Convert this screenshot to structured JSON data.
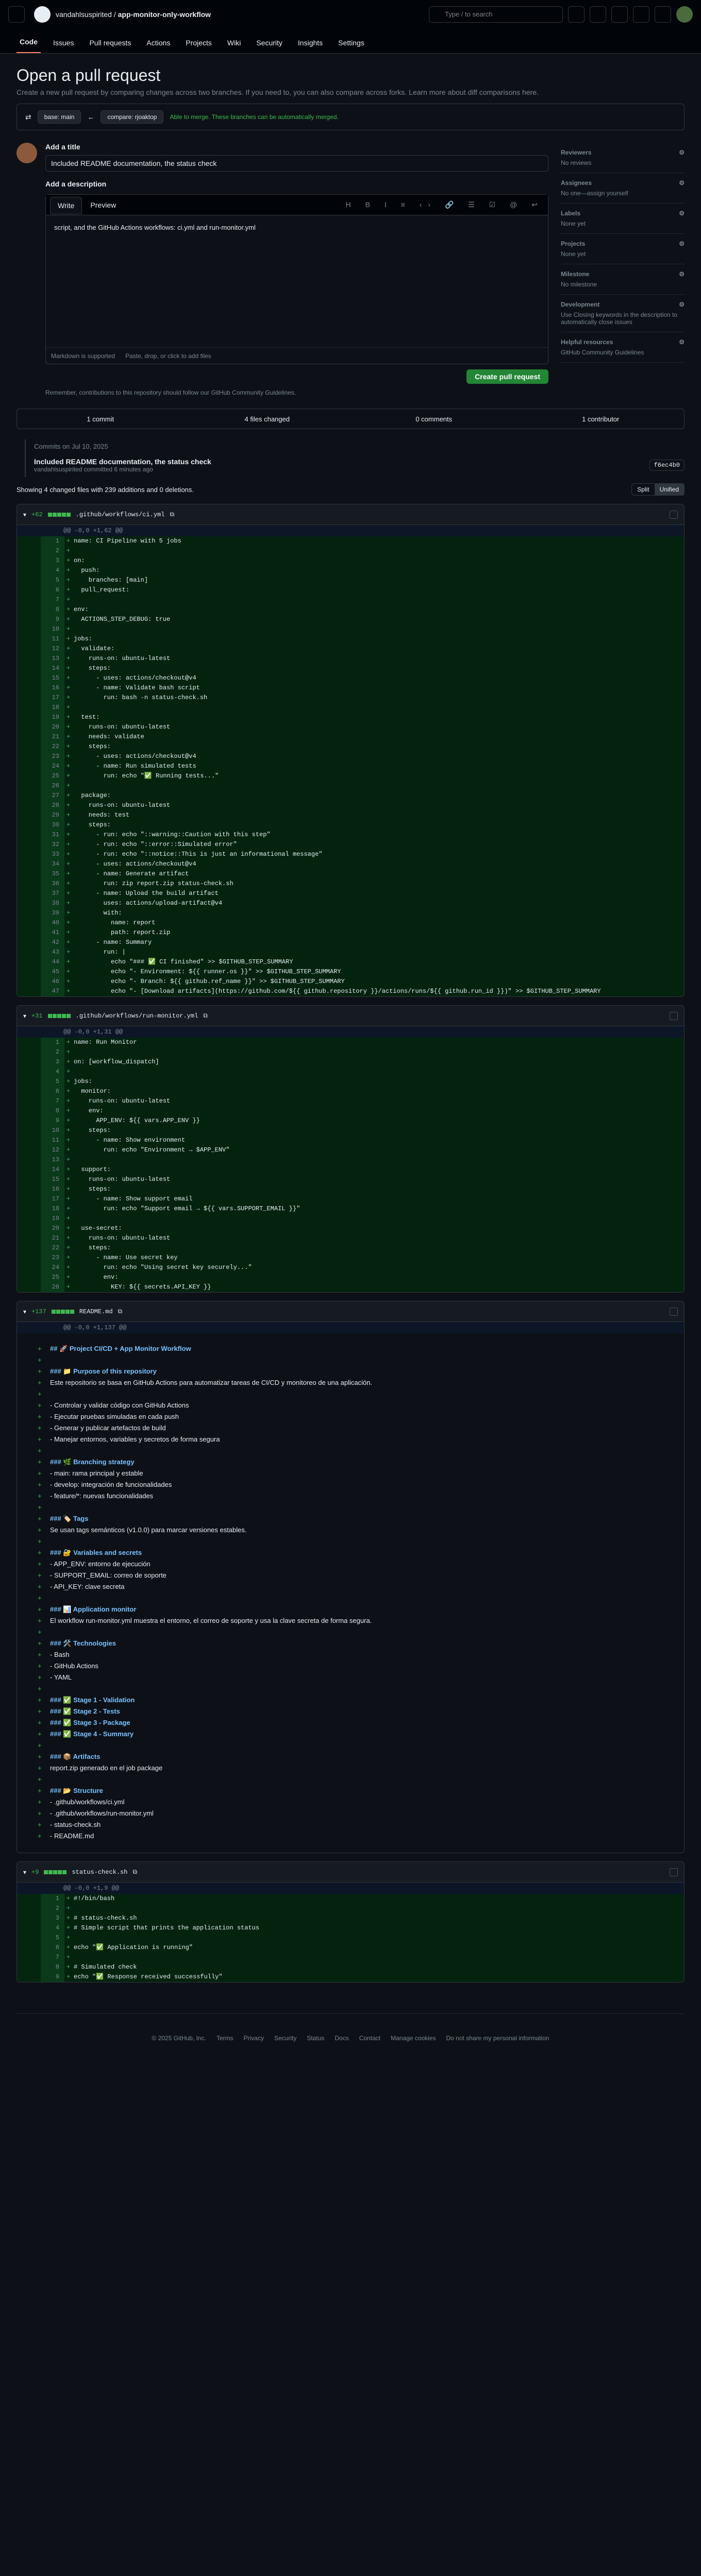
{
  "header": {
    "owner": "vandahlsuspirited",
    "repo": "app-monitor-only-workflow",
    "search_placeholder": "Type / to search"
  },
  "tabs": [
    "Code",
    "Issues",
    "Pull requests",
    "Actions",
    "Projects",
    "Wiki",
    "Security",
    "Insights",
    "Settings"
  ],
  "page": {
    "title": "Open a pull request",
    "subtitle": "Create a new pull request by comparing changes across two branches. If you need to, you can also compare across forks. Learn more about diff comparisons here."
  },
  "compare": {
    "base": "base: main",
    "head": "compare: rjoaktop",
    "able": "Able to merge. These branches can be automatically merged."
  },
  "form": {
    "title_label": "Add a title",
    "title_value": "Included README documentation, the status check",
    "desc_label": "Add a description",
    "write": "Write",
    "preview": "Preview",
    "body": "script, and the GitHub Actions workflows: ci.yml and run-monitor.yml",
    "md": "Markdown is supported",
    "attach": "Paste, drop, or click to add files",
    "create": "Create pull request",
    "remark": "Remember, contributions to this repository should follow our GitHub Community Guidelines."
  },
  "sidebar": [
    {
      "t": "Reviewers",
      "v": "No reviews"
    },
    {
      "t": "Assignees",
      "v": "No one—assign yourself"
    },
    {
      "t": "Labels",
      "v": "None yet"
    },
    {
      "t": "Projects",
      "v": "None yet"
    },
    {
      "t": "Milestone",
      "v": "No milestone"
    },
    {
      "t": "Development",
      "v": "Use Closing keywords in the description to automatically close issues"
    },
    {
      "t": "Helpful resources",
      "v": "GitHub Community Guidelines"
    }
  ],
  "stats": [
    "1 commit",
    "4 files changed",
    "0 comments",
    "1 contributor"
  ],
  "timeline": {
    "date": "Commits on Jul 10, 2025",
    "msg": "Included README documentation, the status check",
    "author": "vandahlsuspirited committed 6 minutes ago",
    "sha": "f6ec4b0"
  },
  "showing": "Showing 4 changed files with 239 additions and 0 deletions.",
  "view": [
    "Split",
    "Unified"
  ],
  "files": [
    {
      "name": ".github/workflows/ci.yml",
      "adds": "+62",
      "hunk": "@@ -0,0 +1,62 @@",
      "lines": [
        "name: CI Pipeline with 5 jobs",
        "",
        "on:",
        "  push:",
        "    branches: [main]",
        "  pull_request:",
        "",
        "env:",
        "  ACTIONS_STEP_DEBUG: true",
        "",
        "jobs:",
        "  validate:",
        "    runs-on: ubuntu-latest",
        "    steps:",
        "      - uses: actions/checkout@v4",
        "      - name: Validate bash script",
        "        run: bash -n status-check.sh",
        "",
        "  test:",
        "    runs-on: ubuntu-latest",
        "    needs: validate",
        "    steps:",
        "      - uses: actions/checkout@v4",
        "      - name: Run simulated tests",
        "        run: echo \"✅ Running tests...\"",
        "",
        "  package:",
        "    runs-on: ubuntu-latest",
        "    needs: test",
        "    steps:",
        "      - run: echo \"::warning::Caution with this step\"",
        "      - run: echo \"::error::Simulated error\"",
        "      - run: echo \"::notice::This is just an informational message\"",
        "      - uses: actions/checkout@v4",
        "      - name: Generate artifact",
        "        run: zip report.zip status-check.sh",
        "      - name: Upload the build artifact",
        "        uses: actions/upload-artifact@v4",
        "        with:",
        "          name: report",
        "          path: report.zip",
        "      - name: Summary",
        "        run: |",
        "          echo \"### ✅ CI finished\" >> $GITHUB_STEP_SUMMARY",
        "          echo \"- Environment: ${{ runner.os }}\" >> $GITHUB_STEP_SUMMARY",
        "          echo \"- Branch: ${{ github.ref_name }}\" >> $GITHUB_STEP_SUMMARY",
        "          echo \"- [Download artifacts](https://github.com/${{ github.repository }}/actions/runs/${{ github.run_id }})\" >> $GITHUB_STEP_SUMMARY"
      ]
    },
    {
      "name": ".github/workflows/run-monitor.yml",
      "adds": "+31",
      "hunk": "@@ -0,0 +1,31 @@",
      "lines": [
        "name: Run Monitor",
        "",
        "on: [workflow_dispatch]",
        "",
        "jobs:",
        "  monitor:",
        "    runs-on: ubuntu-latest",
        "    env:",
        "      APP_ENV: ${{ vars.APP_ENV }}",
        "    steps:",
        "      - name: Show environment",
        "        run: echo \"Environment → $APP_ENV\"",
        "",
        "  support:",
        "    runs-on: ubuntu-latest",
        "    steps:",
        "      - name: Show support email",
        "        run: echo \"Support email → ${{ vars.SUPPORT_EMAIL }}\"",
        "",
        "  use-secret:",
        "    runs-on: ubuntu-latest",
        "    steps:",
        "      - name: Use secret key",
        "        run: echo \"Using secret key securely...\"",
        "        env:",
        "          KEY: ${{ secrets.API_KEY }}"
      ]
    },
    {
      "name": "README.md",
      "adds": "+137",
      "hunk": "@@ -0,0 +1,137 @@",
      "preview": [
        "## 🚀 Project CI/CD + App Monitor Workflow",
        "",
        "### 📁 Purpose of this repository",
        "Este repositorio se basa en GitHub Actions para automatizar tareas de CI/CD y monitoreo de una aplicación.",
        "",
        "- Controlar y validar código con GitHub Actions",
        "- Ejecutar pruebas simuladas en cada push",
        "- Generar y publicar artefactos de build",
        "- Manejar entornos, variables y secretos de forma segura",
        "",
        "### 🌿 Branching strategy",
        "- main: rama principal y estable",
        "- develop: integración de funcionalidades",
        "- feature/*: nuevas funcionalidades",
        "",
        "### 🏷️ Tags",
        "Se usan tags semánticos (v1.0.0) para marcar versiones estables.",
        "",
        "### 🔐 Variables and secrets",
        "- APP_ENV: entorno de ejecución",
        "- SUPPORT_EMAIL: correo de soporte",
        "- API_KEY: clave secreta",
        "",
        "### 📊 Application monitor",
        "El workflow run-monitor.yml muestra el entorno, el correo de soporte y usa la clave secreta de forma segura.",
        "",
        "### 🛠️ Technologies",
        "- Bash",
        "- GitHub Actions",
        "- YAML",
        "",
        "### ✅ Stage 1 - Validation",
        "### ✅ Stage 2 - Tests",
        "### ✅ Stage 3 - Package",
        "### ✅ Stage 4 - Summary",
        "",
        "### 📦 Artifacts",
        "report.zip generado en el job package",
        "",
        "### 📂 Structure",
        "- .github/workflows/ci.yml",
        "- .github/workflows/run-monitor.yml",
        "- status-check.sh",
        "- README.md"
      ]
    },
    {
      "name": "status-check.sh",
      "adds": "+9",
      "hunk": "@@ -0,0 +1,9 @@",
      "lines": [
        "#!/bin/bash",
        "",
        "# status-check.sh",
        "# Simple script that prints the application status",
        "",
        "echo \"✅ Application is running\"",
        "",
        "# Simulated check",
        "echo \"✅ Response received successfully\""
      ]
    }
  ],
  "footer": [
    "© 2025 GitHub, Inc.",
    "Terms",
    "Privacy",
    "Security",
    "Status",
    "Docs",
    "Contact",
    "Manage cookies",
    "Do not share my personal information"
  ]
}
